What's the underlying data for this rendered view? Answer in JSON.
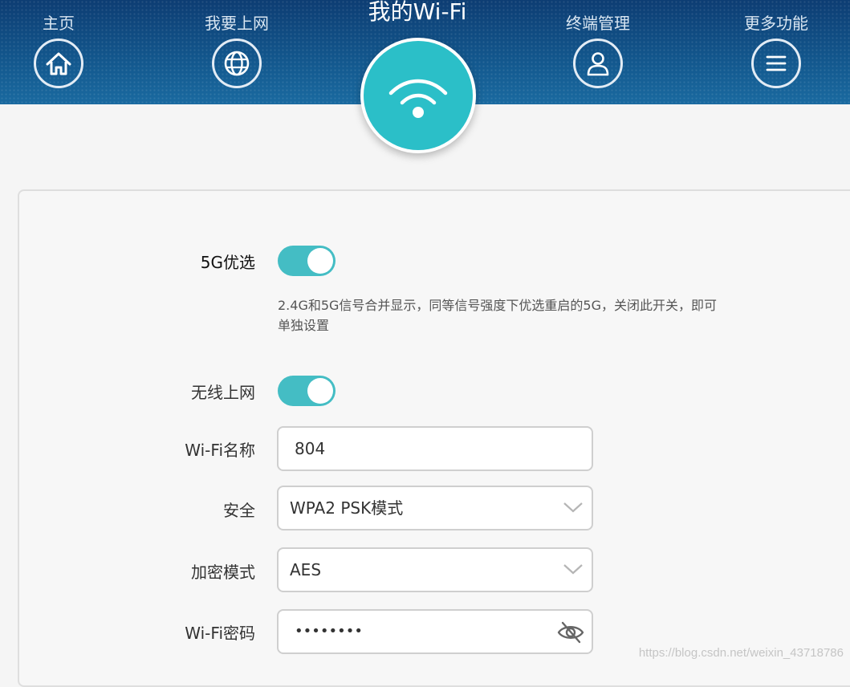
{
  "nav": {
    "home": "主页",
    "internet": "我要上网",
    "my_wifi": "我的Wi-Fi",
    "devices": "终端管理",
    "more": "更多功能",
    "icons": {
      "home": "house-icon",
      "internet": "globe-icon",
      "my_wifi": "wifi-icon",
      "devices": "user-icon",
      "more": "menu-icon"
    }
  },
  "settings": {
    "five_g_pref": {
      "label": "5G优选",
      "enabled": true,
      "description": "2.4G和5G信号合并显示，同等信号强度下优选重启的5G，关闭此开关，即可单独设置"
    },
    "wireless": {
      "label": "无线上网",
      "enabled": true
    },
    "ssid": {
      "label": "Wi-Fi名称",
      "value": "804"
    },
    "security": {
      "label": "安全",
      "value": "WPA2 PSK模式"
    },
    "encryption": {
      "label": "加密模式",
      "value": "AES"
    },
    "password": {
      "label": "Wi-Fi密码",
      "value": "••••••••"
    }
  },
  "watermark": "https://blog.csdn.net/weixin_43718786",
  "colors": {
    "header": "#13588e",
    "accent": "#2bbfc8",
    "toggle": "#44bdc4"
  }
}
